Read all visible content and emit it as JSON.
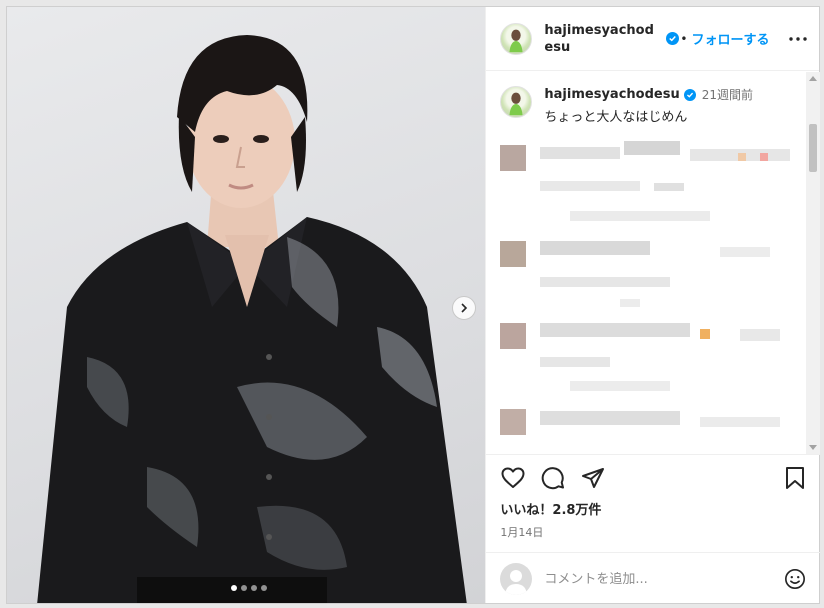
{
  "post": {
    "username": "hajimesyachodesu",
    "follow_label": "フォローする",
    "separator": "•",
    "caption_time": "21週間前",
    "caption_text": "ちょっと大人なはじめん",
    "likes_text": "いいね！2.8万件",
    "date_text": "1月14日",
    "comment_placeholder": "コメントを追加..."
  },
  "carousel": {
    "slide_count": 4,
    "active_index": 0
  },
  "icons": {
    "verified": "verified-badge-icon",
    "more": "more-options-icon",
    "next": "chevron-right-icon",
    "like": "heart-icon",
    "comment": "comment-bubble-icon",
    "share": "paper-plane-icon",
    "save": "bookmark-icon",
    "emoji": "emoji-smile-icon"
  },
  "colors": {
    "accent": "#0095f6",
    "text": "#262626",
    "muted": "#737373"
  }
}
